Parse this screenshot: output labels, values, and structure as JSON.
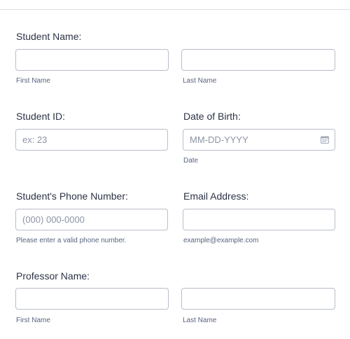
{
  "student_name": {
    "label": "Student Name:",
    "first": {
      "value": "",
      "sublabel": "First Name"
    },
    "last": {
      "value": "",
      "sublabel": "Last Name"
    }
  },
  "student_id": {
    "label": "Student ID:",
    "value": "",
    "placeholder": "ex: 23"
  },
  "date_of_birth": {
    "label": "Date of Birth:",
    "value": "",
    "placeholder": "MM-DD-YYYY",
    "sublabel": "Date",
    "icon": "calendar-icon"
  },
  "phone": {
    "label": "Student's Phone Number:",
    "value": "",
    "placeholder": "(000) 000-0000",
    "sublabel": "Please enter a valid phone number."
  },
  "email": {
    "label": "Email Address:",
    "value": "",
    "sublabel": "example@example.com"
  },
  "professor_name": {
    "label": "Professor Name:",
    "first": {
      "value": "",
      "sublabel": "First Name"
    },
    "last": {
      "value": "",
      "sublabel": "Last Name"
    }
  },
  "colors": {
    "label": "#2c3345",
    "sublabel": "#57647e",
    "border": "#b8bdc9",
    "placeholder": "#8d94a6"
  }
}
